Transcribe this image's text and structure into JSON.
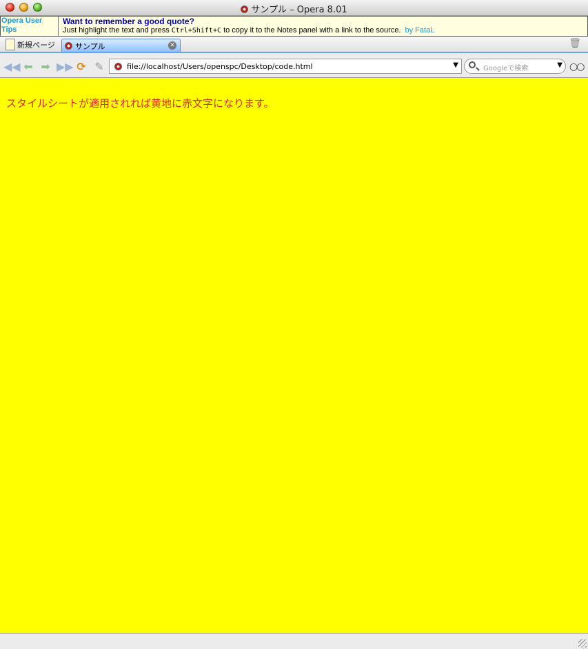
{
  "window": {
    "title": "サンプル – Opera 8.01"
  },
  "tips": {
    "label": "Opera User Tips",
    "heading": "Want to remember a good quote?",
    "body_pre": "Just highlight the text and press ",
    "shortcut": "Ctrl+Shift+C",
    "body_post": " to copy it to the Notes panel with a link to the source.",
    "author_link": "by FataL"
  },
  "tabs": {
    "new_page_label": "新規ページ",
    "active_tab_label": "サンプル"
  },
  "navigation": {
    "url": "file://localhost/Users/openspc/Desktop/code.html",
    "search_placeholder": "Googleで検索"
  },
  "page": {
    "text": "スタイルシートが適用されれば黄地に赤文字になります。",
    "background_color": "#ffff00",
    "text_color": "#e0281e"
  }
}
